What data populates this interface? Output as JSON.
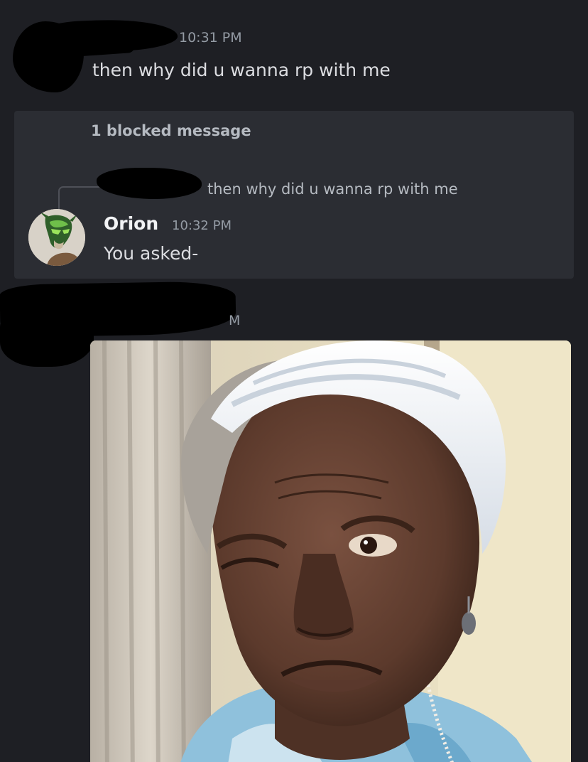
{
  "message1": {
    "timestamp": "10:31 PM",
    "text": "then why did u wanna rp with me"
  },
  "blocked": {
    "label": "1 blocked message",
    "reply_preview": "then why did u wanna rp with me",
    "author": "Orion",
    "timestamp": "10:32 PM",
    "text": "You asked-"
  },
  "message3": {
    "timestamp_tail": "M"
  },
  "colors": {
    "background": "#1e1f24",
    "blocked_box": "#2b2d33",
    "timestamp": "#949ba4",
    "message_text": "#dcdde1"
  }
}
